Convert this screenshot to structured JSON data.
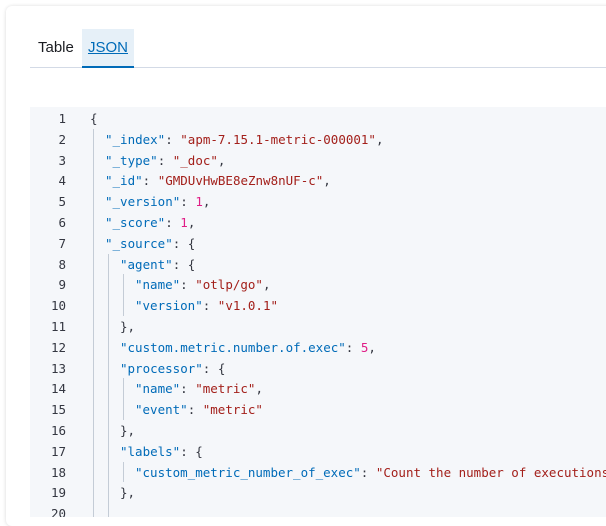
{
  "tabs": [
    {
      "label": "Table",
      "active": false
    },
    {
      "label": "JSON",
      "active": true
    }
  ],
  "colors": {
    "key": "#006bb8",
    "string": "#a3201b",
    "number": "#e01e86",
    "accent": "#006bb8"
  },
  "code_lines": [
    {
      "num": "1",
      "indent": 0,
      "tokens": [
        {
          "t": "{",
          "c": "p"
        }
      ]
    },
    {
      "num": "2",
      "indent": 1,
      "tokens": [
        {
          "t": "\"_index\"",
          "c": "k"
        },
        {
          "t": ": ",
          "c": "p"
        },
        {
          "t": "\"apm-7.15.1-metric-000001\"",
          "c": "s"
        },
        {
          "t": ",",
          "c": "p"
        }
      ]
    },
    {
      "num": "3",
      "indent": 1,
      "tokens": [
        {
          "t": "\"_type\"",
          "c": "k"
        },
        {
          "t": ": ",
          "c": "p"
        },
        {
          "t": "\"_doc\"",
          "c": "s"
        },
        {
          "t": ",",
          "c": "p"
        }
      ]
    },
    {
      "num": "4",
      "indent": 1,
      "tokens": [
        {
          "t": "\"_id\"",
          "c": "k"
        },
        {
          "t": ": ",
          "c": "p"
        },
        {
          "t": "\"GMDUvHwBE8eZnw8nUF-c\"",
          "c": "s"
        },
        {
          "t": ",",
          "c": "p"
        }
      ]
    },
    {
      "num": "5",
      "indent": 1,
      "tokens": [
        {
          "t": "\"_version\"",
          "c": "k"
        },
        {
          "t": ": ",
          "c": "p"
        },
        {
          "t": "1",
          "c": "n"
        },
        {
          "t": ",",
          "c": "p"
        }
      ]
    },
    {
      "num": "6",
      "indent": 1,
      "tokens": [
        {
          "t": "\"_score\"",
          "c": "k"
        },
        {
          "t": ": ",
          "c": "p"
        },
        {
          "t": "1",
          "c": "n"
        },
        {
          "t": ",",
          "c": "p"
        }
      ]
    },
    {
      "num": "7",
      "indent": 1,
      "tokens": [
        {
          "t": "\"_source\"",
          "c": "k"
        },
        {
          "t": ": {",
          "c": "p"
        }
      ]
    },
    {
      "num": "8",
      "indent": 2,
      "tokens": [
        {
          "t": "\"agent\"",
          "c": "k"
        },
        {
          "t": ": {",
          "c": "p"
        }
      ]
    },
    {
      "num": "9",
      "indent": 3,
      "tokens": [
        {
          "t": "\"name\"",
          "c": "k"
        },
        {
          "t": ": ",
          "c": "p"
        },
        {
          "t": "\"otlp/go\"",
          "c": "s"
        },
        {
          "t": ",",
          "c": "p"
        }
      ]
    },
    {
      "num": "10",
      "indent": 3,
      "tokens": [
        {
          "t": "\"version\"",
          "c": "k"
        },
        {
          "t": ": ",
          "c": "p"
        },
        {
          "t": "\"v1.0.1\"",
          "c": "s"
        }
      ]
    },
    {
      "num": "11",
      "indent": 2,
      "tokens": [
        {
          "t": "},",
          "c": "p"
        }
      ]
    },
    {
      "num": "12",
      "indent": 2,
      "tokens": [
        {
          "t": "\"custom.metric.number.of.exec\"",
          "c": "k"
        },
        {
          "t": ": ",
          "c": "p"
        },
        {
          "t": "5",
          "c": "n"
        },
        {
          "t": ",",
          "c": "p"
        }
      ]
    },
    {
      "num": "13",
      "indent": 2,
      "tokens": [
        {
          "t": "\"processor\"",
          "c": "k"
        },
        {
          "t": ": {",
          "c": "p"
        }
      ]
    },
    {
      "num": "14",
      "indent": 3,
      "tokens": [
        {
          "t": "\"name\"",
          "c": "k"
        },
        {
          "t": ": ",
          "c": "p"
        },
        {
          "t": "\"metric\"",
          "c": "s"
        },
        {
          "t": ",",
          "c": "p"
        }
      ]
    },
    {
      "num": "15",
      "indent": 3,
      "tokens": [
        {
          "t": "\"event\"",
          "c": "k"
        },
        {
          "t": ": ",
          "c": "p"
        },
        {
          "t": "\"metric\"",
          "c": "s"
        }
      ]
    },
    {
      "num": "16",
      "indent": 2,
      "tokens": [
        {
          "t": "},",
          "c": "p"
        }
      ]
    },
    {
      "num": "17",
      "indent": 2,
      "tokens": [
        {
          "t": "\"labels\"",
          "c": "k"
        },
        {
          "t": ": {",
          "c": "p"
        }
      ]
    },
    {
      "num": "18",
      "indent": 3,
      "tokens": [
        {
          "t": "\"custom_metric_number_of_exec\"",
          "c": "k"
        },
        {
          "t": ": ",
          "c": "p"
        },
        {
          "t": "\"Count the number of executions.\"",
          "c": "s"
        }
      ]
    },
    {
      "num": "19",
      "indent": 2,
      "tokens": [
        {
          "t": "},",
          "c": "p"
        }
      ]
    },
    {
      "num": "20",
      "indent": 2,
      "tokens": [
        {
          "t": "",
          "c": "p"
        }
      ]
    }
  ]
}
